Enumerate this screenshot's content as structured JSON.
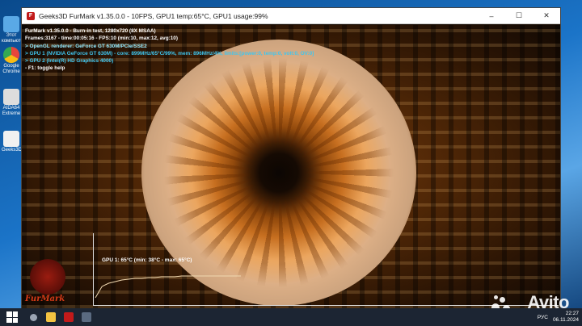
{
  "window": {
    "title": "Geeks3D FurMark v1.35.0.0 - 10FPS, GPU1 temp:65°C, GPU1 usage:99%",
    "controls": [
      "–",
      "☐",
      "✕"
    ]
  },
  "hud": {
    "line1": "FurMark v1.35.0.0 - Burn-in test, 1280x720 (8X MSAA)",
    "line2": "Frames:3167 - time:00:05:16 - FPS:10 (min:10, max:12, avg:10)",
    "line3": "> OpenGL renderer: GeForce GT 630M/PCIe/SSE2",
    "line4": "> GPU 1 (NVIDIA GeForce GT 630M) - core: 899MHz/65°C/99%, mem: 896MHz/4%, limits:[power:0, temp:0, volt:0, OV:0]",
    "line5": "> GPU 2 (Intel(R) HD Graphics 4000)",
    "line6": "- F1: toggle help"
  },
  "graph": {
    "label": "GPU 1: 65°C (min: 38°C - max: 65°C)",
    "line_color": "#f0d8b0",
    "temps": [
      38,
      52,
      56,
      58,
      60,
      61,
      62,
      62,
      63,
      63,
      64,
      64,
      64,
      65,
      65,
      65,
      65,
      65,
      65,
      65,
      65,
      65,
      65
    ]
  },
  "logo": {
    "text": "FurMark"
  },
  "desktop_icons": [
    {
      "label": "Этот компьютер",
      "color": "#5aa9e6"
    },
    {
      "label": "Google Chrome",
      "color": "#e8453c"
    },
    {
      "label": "AIDA64 Extreme",
      "color": "#dddddd"
    },
    {
      "label": "Geeks3D",
      "color": "#f1f1f1"
    }
  ],
  "taskbar": {
    "items": [
      {
        "name": "search",
        "color": "#9aa4b3"
      },
      {
        "name": "file-explorer",
        "color": "#f3c341"
      },
      {
        "name": "furmark",
        "color": "#c21a1a"
      },
      {
        "name": "gpu-shark",
        "color": "#5a6a80"
      }
    ],
    "lang": "РУС",
    "time": "22:27",
    "date": "06.11.2024"
  },
  "watermark": "Avito"
}
